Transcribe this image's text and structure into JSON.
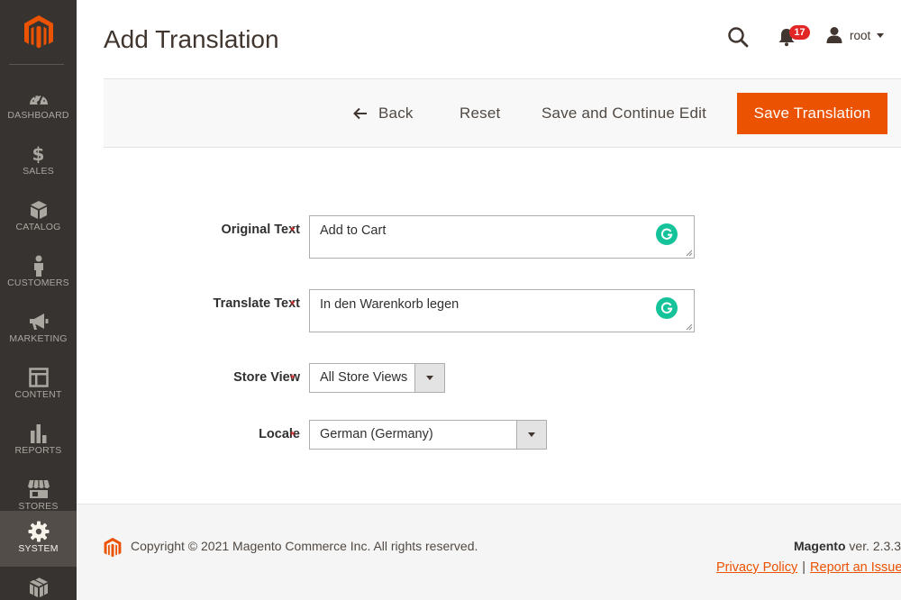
{
  "app": {
    "brand_color": "#eb5202",
    "sidebar_bg": "#373330"
  },
  "sidebar": {
    "items": [
      {
        "label": "DASHBOARD",
        "icon": "dashboard-icon"
      },
      {
        "label": "SALES",
        "icon": "dollar-icon"
      },
      {
        "label": "CATALOG",
        "icon": "box-icon"
      },
      {
        "label": "CUSTOMERS",
        "icon": "person-icon"
      },
      {
        "label": "MARKETING",
        "icon": "megaphone-icon"
      },
      {
        "label": "CONTENT",
        "icon": "layout-icon"
      },
      {
        "label": "REPORTS",
        "icon": "bar-chart-icon"
      },
      {
        "label": "STORES",
        "icon": "storefront-icon"
      },
      {
        "label": "SYSTEM",
        "icon": "gear-icon",
        "active": true
      },
      {
        "label": "",
        "icon": "cubes-icon"
      }
    ]
  },
  "header": {
    "title": "Add Translation",
    "notifications_count": "17",
    "user_name": "root"
  },
  "actions": {
    "back": "Back",
    "reset": "Reset",
    "save_continue": "Save and Continue Edit",
    "save": "Save Translation"
  },
  "form": {
    "original_text": {
      "label": "Original Text",
      "value": "Add to Cart"
    },
    "translate_text": {
      "label": "Translate Text",
      "value": "In den Warenkorb legen"
    },
    "store_view": {
      "label": "Store View",
      "value": "All Store Views"
    },
    "locale": {
      "label": "Locale",
      "value": "German (Germany)"
    },
    "required_mark": "*"
  },
  "footer": {
    "copyright": "Copyright © 2021 Magento Commerce Inc. All rights reserved.",
    "brand": "Magento",
    "version": " ver. 2.3.3",
    "privacy": "Privacy Policy",
    "separator": "|",
    "report": "Report an Issue"
  }
}
